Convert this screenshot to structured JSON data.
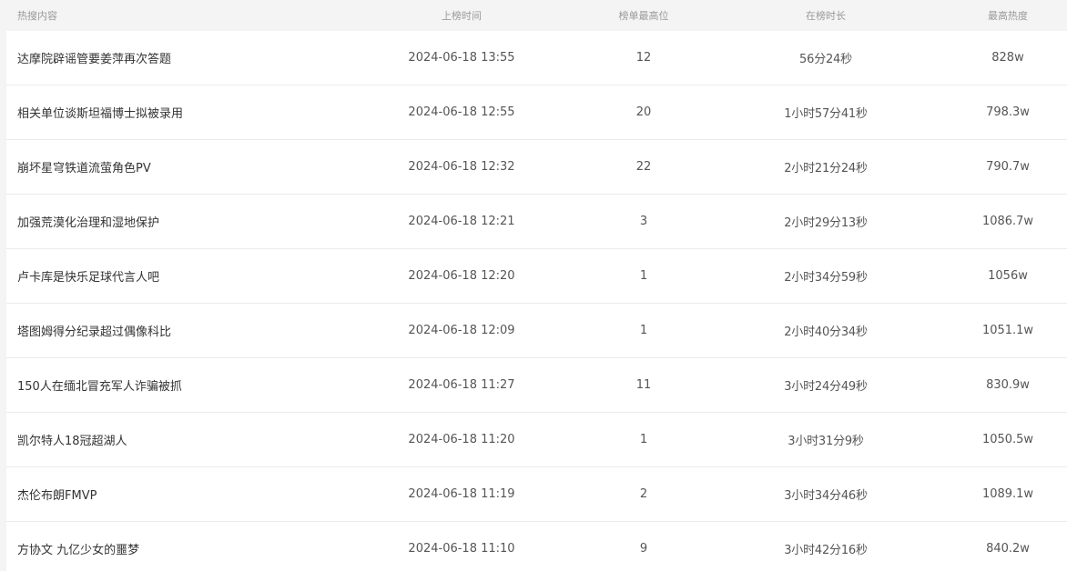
{
  "table": {
    "headers": {
      "title": "热搜内容",
      "time": "上榜时间",
      "rank": "榜单最高位",
      "duration": "在榜时长",
      "heat": "最高热度"
    },
    "rows": [
      {
        "title": "达摩院辟谣管要姜萍再次答题",
        "time": "2024-06-18 13:55",
        "rank": "12",
        "duration": "56分24秒",
        "heat": "828w"
      },
      {
        "title": "相关单位谈斯坦福博士拟被录用",
        "time": "2024-06-18 12:55",
        "rank": "20",
        "duration": "1小时57分41秒",
        "heat": "798.3w"
      },
      {
        "title": "崩坏星穹铁道流萤角色PV",
        "time": "2024-06-18 12:32",
        "rank": "22",
        "duration": "2小时21分24秒",
        "heat": "790.7w"
      },
      {
        "title": "加强荒漠化治理和湿地保护",
        "time": "2024-06-18 12:21",
        "rank": "3",
        "duration": "2小时29分13秒",
        "heat": "1086.7w"
      },
      {
        "title": "卢卡库是快乐足球代言人吧",
        "time": "2024-06-18 12:20",
        "rank": "1",
        "duration": "2小时34分59秒",
        "heat": "1056w"
      },
      {
        "title": "塔图姆得分纪录超过偶像科比",
        "time": "2024-06-18 12:09",
        "rank": "1",
        "duration": "2小时40分34秒",
        "heat": "1051.1w"
      },
      {
        "title": "150人在缅北冒充军人诈骗被抓",
        "time": "2024-06-18 11:27",
        "rank": "11",
        "duration": "3小时24分49秒",
        "heat": "830.9w"
      },
      {
        "title": "凯尔特人18冠超湖人",
        "time": "2024-06-18 11:20",
        "rank": "1",
        "duration": "3小时31分9秒",
        "heat": "1050.5w"
      },
      {
        "title": "杰伦布朗FMVP",
        "time": "2024-06-18 11:19",
        "rank": "2",
        "duration": "3小时34分46秒",
        "heat": "1089.1w"
      },
      {
        "title": "方协文 九亿少女的噩梦",
        "time": "2024-06-18 11:10",
        "rank": "9",
        "duration": "3小时42分16秒",
        "heat": "840.2w"
      }
    ]
  }
}
